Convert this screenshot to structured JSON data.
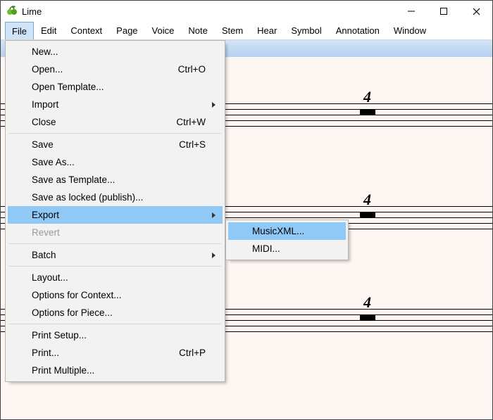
{
  "title": "Lime",
  "menubar": [
    "File",
    "Edit",
    "Context",
    "Page",
    "Voice",
    "Note",
    "Stem",
    "Hear",
    "Symbol",
    "Annotation",
    "Window"
  ],
  "file_menu": {
    "new": "New...",
    "open": "Open...",
    "open_sc": "Ctrl+O",
    "open_template": "Open Template...",
    "import": "Import",
    "close": "Close",
    "close_sc": "Ctrl+W",
    "save": "Save",
    "save_sc": "Ctrl+S",
    "save_as": "Save As...",
    "save_as_template": "Save as Template...",
    "save_locked": "Save as locked (publish)...",
    "export": "Export",
    "revert": "Revert",
    "batch": "Batch",
    "layout": "Layout...",
    "opts_context": "Options for Context...",
    "opts_piece": "Options for Piece...",
    "print_setup": "Print Setup...",
    "print": "Print...",
    "print_sc": "Ctrl+P",
    "print_multiple": "Print Multiple..."
  },
  "export_submenu": {
    "musicxml": "MusicXML...",
    "midi": "MIDI..."
  },
  "score": {
    "timesig": "4"
  }
}
